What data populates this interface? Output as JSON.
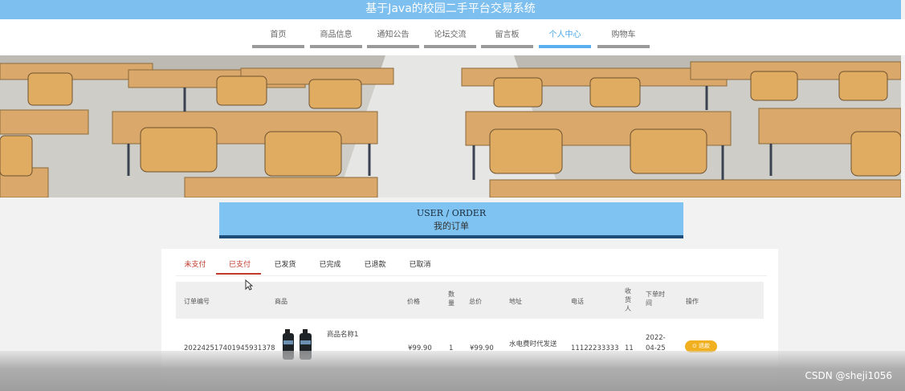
{
  "header": {
    "title": "基于Java的校园二手平台交易系统"
  },
  "nav": {
    "items": [
      {
        "label": "首页"
      },
      {
        "label": "商品信息"
      },
      {
        "label": "通知公告"
      },
      {
        "label": "论坛交流"
      },
      {
        "label": "留言板"
      },
      {
        "label": "个人中心",
        "active": true
      },
      {
        "label": "购物车"
      }
    ]
  },
  "section": {
    "title_en": "USER / ORDER",
    "title_cn": "我的订单"
  },
  "order_tabs": [
    {
      "label": "未支付"
    },
    {
      "label": "已支付",
      "active": true
    },
    {
      "label": "已发货"
    },
    {
      "label": "已完成"
    },
    {
      "label": "已退款"
    },
    {
      "label": "已取消"
    }
  ],
  "table": {
    "headers": {
      "order_no": "订单编号",
      "product": "商品",
      "price": "价格",
      "qty_1": "数",
      "qty_2": "量",
      "total": "总价",
      "address": "地址",
      "phone": "电话",
      "receiver_1": "收",
      "receiver_2": "货",
      "receiver_3": "人",
      "order_time_1": "下单时",
      "order_time_2": "间",
      "action": "操作"
    },
    "rows": [
      {
        "order_no": "20224251740194593 1378",
        "order_no_display": "202242517401945931378",
        "product_name": "商品名称1",
        "price": "¥99.90",
        "qty": "1",
        "total": "¥99.90",
        "address": "水电费时代发送",
        "phone": "11122233333",
        "receiver": "11",
        "time_1": "2022-",
        "time_2": "04-25",
        "action": "退款"
      }
    ]
  },
  "watermark": "CSDN @sheji1056",
  "colors": {
    "accent": "#7dbfef",
    "tab_active": "#c0392b",
    "pay_button": "#f0b020"
  }
}
